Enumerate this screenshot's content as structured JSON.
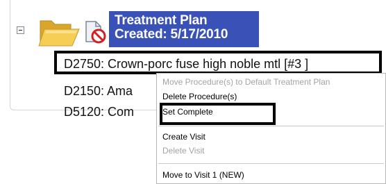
{
  "plan": {
    "title_line1": "Treatment Plan",
    "title_line2": "Created: 5/17/2010"
  },
  "procedures": [
    {
      "label": "D2750: Crown-porc fuse high noble mtl [#3 ]"
    },
    {
      "label": "D2150: Ama"
    },
    {
      "label": "D5120: Com",
      "tail": "]"
    }
  ],
  "context_menu": {
    "items": [
      {
        "label": "Move Procedure(s) to Default Treatment Plan",
        "enabled": false
      },
      {
        "label": "Delete Procedure(s)",
        "enabled": true
      },
      {
        "label": "Set Complete",
        "enabled": true
      },
      {
        "label": "Create Visit",
        "enabled": true
      },
      {
        "label": "Delete Visit",
        "enabled": false
      },
      {
        "label": "Move to Visit 1 (NEW)",
        "enabled": true
      }
    ]
  },
  "icons": {
    "collapse": "minus-box-icon",
    "folder": "open-folder-icon",
    "no_document": "no-document-icon"
  },
  "colors": {
    "header_bg": "#3a51b8",
    "folder": "#f3c23d",
    "no_sign": "#d31f1f"
  }
}
